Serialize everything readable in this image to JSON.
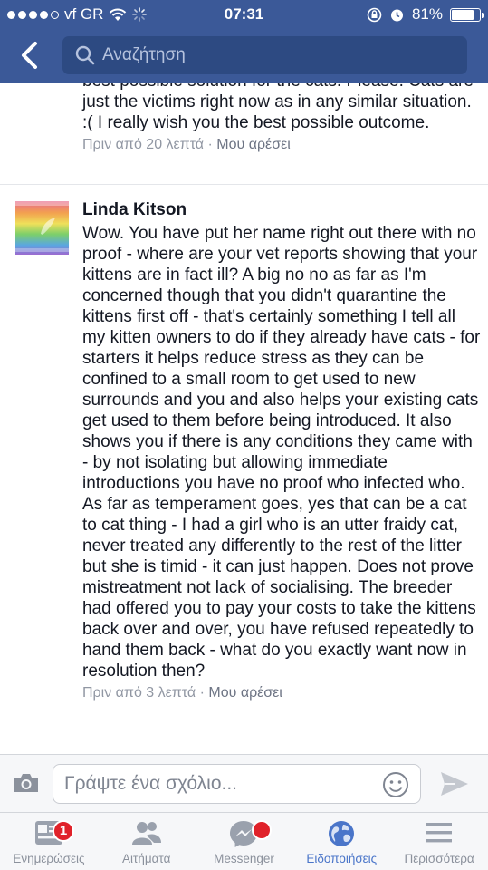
{
  "status_bar": {
    "carrier": "vf GR",
    "time": "07:31",
    "battery_percent": "81%",
    "battery_level": 0.81
  },
  "nav": {
    "search_placeholder": "Αναζήτηση"
  },
  "comments": [
    {
      "text": "best possible solution for the cats. Please. Cats are just the victims right now as in any similar situation. :( I really wish you the best possible outcome.",
      "time": "Πριν από 20 λεπτά",
      "like_label": "Μου αρέσει"
    },
    {
      "author": "Linda Kitson",
      "text": "Wow.  You have put her name right out there with no proof - where are your vet reports showing that your kittens are in fact ill?   A big no no as far as I'm concerned though that you didn't quarantine the kittens first off - that's certainly something I tell all my kitten owners to do if they already have cats - for starters it helps reduce stress as they can be confined to a small room to get used to new surrounds and you and also helps your existing cats get used to them before being introduced.  It also shows you if there is any conditions they came with - by not isolating but allowing immediate introductions you have no proof who infected who.  As far as temperament goes, yes that can be a cat to cat thing - I had a girl who is an utter fraidy cat, never treated any differently to the rest of the litter but she is timid - it can just happen.  Does not prove mistreatment not lack of socialising.   The breeder had offered you to pay your costs to take the kittens back over and over, you have refused repeatedly to hand them back - what do you exactly want now in resolution then?",
      "time": "Πριν από 3 λεπτά",
      "like_label": "Μου αρέσει"
    }
  ],
  "composer": {
    "placeholder": "Γράψτε ένα σχόλιο..."
  },
  "tabbar": {
    "items": [
      {
        "label": "Ενημερώσεις",
        "icon": "news-feed-icon",
        "badge": "1"
      },
      {
        "label": "Αιτήματα",
        "icon": "friend-requests-icon"
      },
      {
        "label": "Messenger",
        "icon": "messenger-icon",
        "has_badge": true
      },
      {
        "label": "Ειδοποιήσεις",
        "icon": "globe-icon",
        "active": true
      },
      {
        "label": "Περισσότερα",
        "icon": "more-menu-icon"
      }
    ]
  },
  "colors": {
    "brand_blue": "#3b5998",
    "active_tab": "#4a75c9",
    "badge_red": "#e0222a"
  }
}
